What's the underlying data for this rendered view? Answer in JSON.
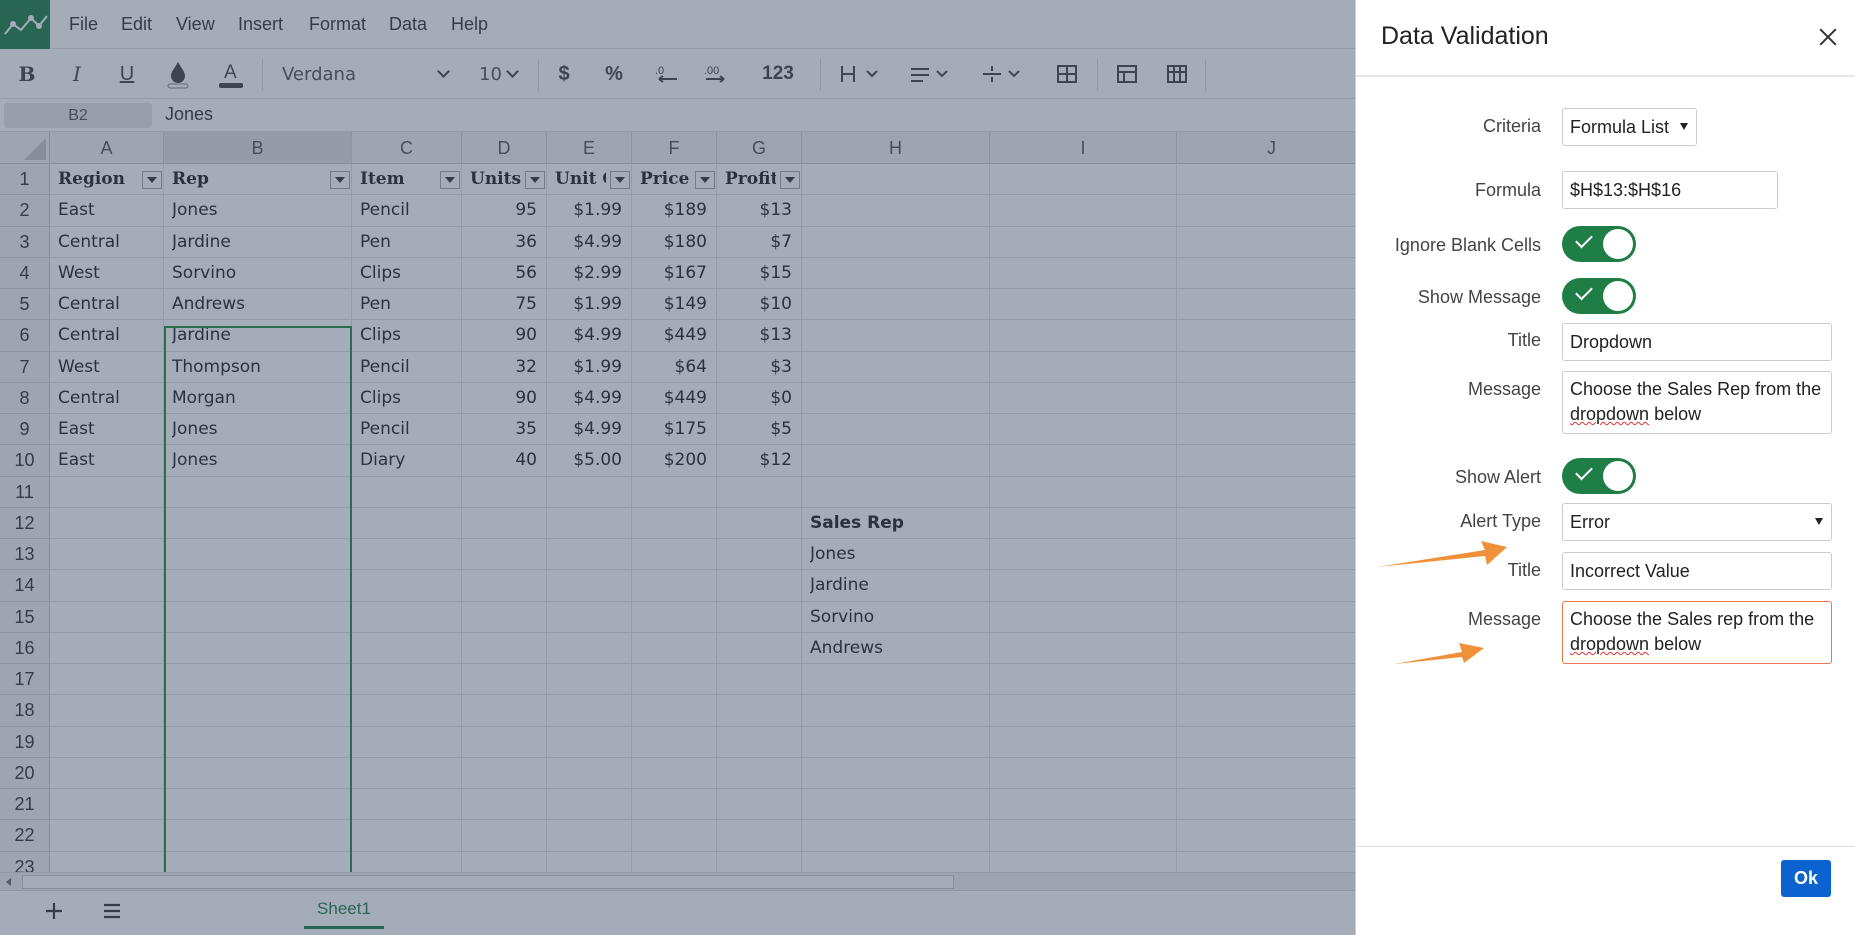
{
  "menu": [
    "File",
    "Edit",
    "View",
    "Insert",
    "Format",
    "Data",
    "Help"
  ],
  "toolbar": {
    "bold": "B",
    "italic": "I",
    "underline": "U",
    "font_name": "Verdana",
    "font_size": "10",
    "currency": "$",
    "percent": "%",
    "number_format": "123",
    "fill_icon": "fill-color-icon",
    "text_color_icon": "text-color-icon"
  },
  "formula_bar": {
    "cell_ref": "B2",
    "value": "Jones"
  },
  "columns": [
    "A",
    "B",
    "C",
    "D",
    "E",
    "F",
    "G",
    "H",
    "I",
    "J"
  ],
  "rows": [
    "1",
    "2",
    "3",
    "4",
    "5",
    "6",
    "7",
    "8",
    "9",
    "10",
    "11",
    "12",
    "13",
    "14",
    "15",
    "16",
    "17",
    "18",
    "19",
    "20",
    "21",
    "22",
    "23"
  ],
  "headers": [
    "Region",
    "Rep",
    "Item",
    "Units",
    "Unit C",
    "Price",
    "Profits"
  ],
  "table": [
    [
      "East",
      "Jones",
      "Pencil",
      "95",
      "$1.99",
      "$189",
      "$13"
    ],
    [
      "Central",
      "Jardine",
      "Pen",
      "36",
      "$4.99",
      "$180",
      "$7"
    ],
    [
      "West",
      "Sorvino",
      "Clips",
      "56",
      "$2.99",
      "$167",
      "$15"
    ],
    [
      "Central",
      "Andrews",
      "Pen",
      "75",
      "$1.99",
      "$149",
      "$10"
    ],
    [
      "Central",
      "Jardine",
      "Clips",
      "90",
      "$4.99",
      "$449",
      "$13"
    ],
    [
      "West",
      "Thompson",
      "Pencil",
      "32",
      "$1.99",
      "$64",
      "$3"
    ],
    [
      "Central",
      "Morgan",
      "Clips",
      "90",
      "$4.99",
      "$449",
      "$0"
    ],
    [
      "East",
      "Jones",
      "Pencil",
      "35",
      "$4.99",
      "$175",
      "$5"
    ],
    [
      "East",
      "Jones",
      "Diary",
      "40",
      "$5.00",
      "$200",
      "$12"
    ]
  ],
  "sales_rep": {
    "title": "Sales Rep",
    "items": [
      "Jones",
      "Jardine",
      "Sorvino",
      "Andrews"
    ]
  },
  "sheet_tab": "Sheet1",
  "panel": {
    "title": "Data Validation",
    "criteria_label": "Criteria",
    "criteria_value": "Formula List",
    "formula_label": "Formula",
    "formula_value": "$H$13:$H$16",
    "ignore_blank_label": "Ignore Blank Cells",
    "show_message_label": "Show Message",
    "title_label": "Title",
    "title_value": "Dropdown",
    "message_label": "Message",
    "message_value_1": "Choose the Sales Rep from the",
    "message_value_2a": "dropdown",
    "message_value_2b": " below",
    "show_alert_label": "Show Alert",
    "alert_type_label": "Alert Type",
    "alert_type_value": "Error",
    "alert_title_label": "Title",
    "alert_title_value": "Incorrect Value",
    "alert_message_label": "Message",
    "alert_message_1": "Choose the Sales rep from the",
    "alert_message_2a": "dropdown",
    "alert_message_2b": " below",
    "ok_label": "Ok"
  },
  "colors": {
    "accent": "#1e7e45",
    "ok_button": "#0b63cf",
    "annotation_arrow": "#f0913a"
  }
}
